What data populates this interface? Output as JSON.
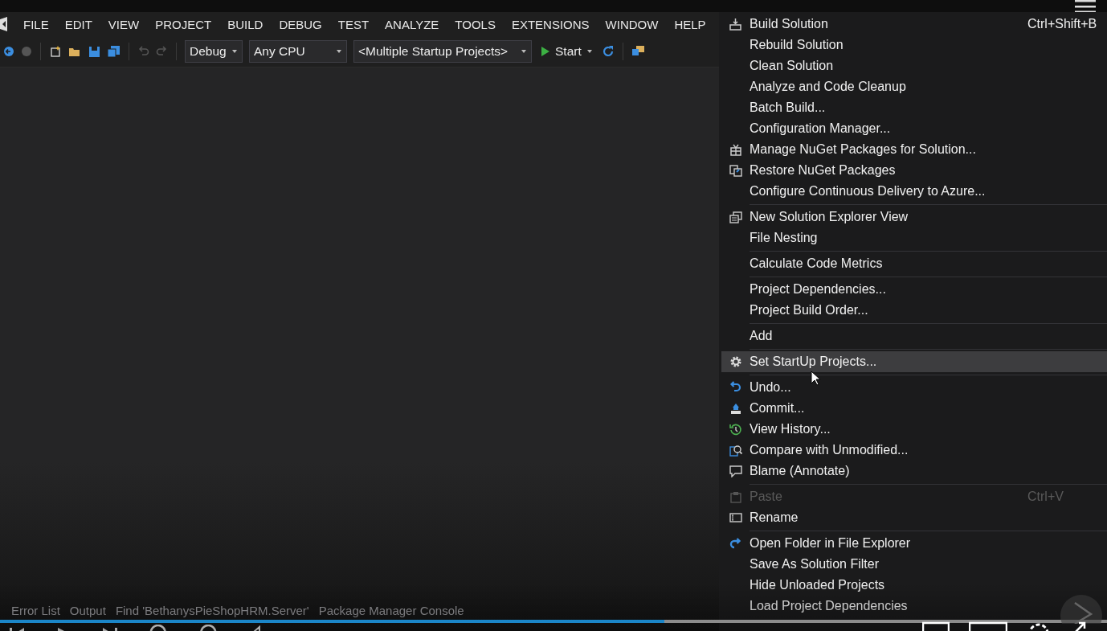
{
  "menubar": {
    "items": [
      "FILE",
      "EDIT",
      "VIEW",
      "PROJECT",
      "BUILD",
      "DEBUG",
      "TEST",
      "ANALYZE",
      "TOOLS",
      "EXTENSIONS",
      "WINDOW",
      "HELP"
    ]
  },
  "toolbar": {
    "configuration": "Debug",
    "platform": "Any CPU",
    "startup": "<Multiple Startup Projects>",
    "start": "Start"
  },
  "context_menu": {
    "groups": [
      {
        "items": [
          {
            "label": "Build Solution",
            "shortcut": "Ctrl+Shift+B",
            "kind": "build",
            "disabled": false,
            "selected": false
          },
          {
            "label": "Rebuild Solution",
            "disabled": false,
            "selected": false
          },
          {
            "label": "Clean Solution",
            "disabled": false,
            "selected": false
          },
          {
            "label": "Analyze and Code Cleanup",
            "disabled": false,
            "selected": false
          },
          {
            "label": "Batch Build...",
            "disabled": false,
            "selected": false
          },
          {
            "label": "Configuration Manager...",
            "disabled": false,
            "selected": false
          },
          {
            "label": "Manage NuGet Packages for Solution...",
            "kind": "package",
            "disabled": false,
            "selected": false
          },
          {
            "label": "Restore NuGet Packages",
            "kind": "restore",
            "disabled": false,
            "selected": false
          },
          {
            "label": "Configure Continuous Delivery to Azure...",
            "disabled": false,
            "selected": false
          }
        ]
      },
      {
        "items": [
          {
            "label": "New Solution Explorer View",
            "kind": "windows",
            "disabled": false,
            "selected": false
          },
          {
            "label": "File Nesting",
            "disabled": false,
            "selected": false
          }
        ]
      },
      {
        "items": [
          {
            "label": "Calculate Code Metrics",
            "disabled": false,
            "selected": false
          }
        ]
      },
      {
        "items": [
          {
            "label": "Project Dependencies...",
            "disabled": false,
            "selected": false
          },
          {
            "label": "Project Build Order...",
            "disabled": false,
            "selected": false
          }
        ]
      },
      {
        "items": [
          {
            "label": "Add",
            "disabled": false,
            "selected": false
          }
        ]
      },
      {
        "items": [
          {
            "label": "Set StartUp Projects...",
            "kind": "gear",
            "disabled": false,
            "selected": true
          }
        ]
      },
      {
        "items": [
          {
            "label": "Undo...",
            "kind": "undo",
            "disabled": false,
            "selected": false
          },
          {
            "label": "Commit...",
            "kind": "commit",
            "disabled": false,
            "selected": false
          },
          {
            "label": "View History...",
            "kind": "history",
            "disabled": false,
            "selected": false
          },
          {
            "label": "Compare with Unmodified...",
            "kind": "compare",
            "disabled": false,
            "selected": false
          },
          {
            "label": "Blame (Annotate)",
            "kind": "comment",
            "disabled": false,
            "selected": false
          }
        ]
      },
      {
        "items": [
          {
            "label": "Paste",
            "shortcut": "Ctrl+V",
            "kind": "paste",
            "disabled": true,
            "selected": false
          },
          {
            "label": "Rename",
            "kind": "rename",
            "disabled": false,
            "selected": false
          }
        ]
      },
      {
        "items": [
          {
            "label": "Open Folder in File Explorer",
            "kind": "redo",
            "disabled": false,
            "selected": false
          },
          {
            "label": "Save As Solution Filter",
            "disabled": false,
            "selected": false
          },
          {
            "label": "Hide Unloaded Projects",
            "disabled": false,
            "selected": false
          },
          {
            "label": "Load Project Dependencies",
            "disabled": false,
            "selected": false
          }
        ]
      }
    ]
  },
  "tool_tabs": [
    "Error List",
    "Output",
    "Find 'BethanysPieShopHRM.Server'",
    "Package Manager Console"
  ],
  "player": {
    "progress": {
      "level": 0.6
    }
  }
}
